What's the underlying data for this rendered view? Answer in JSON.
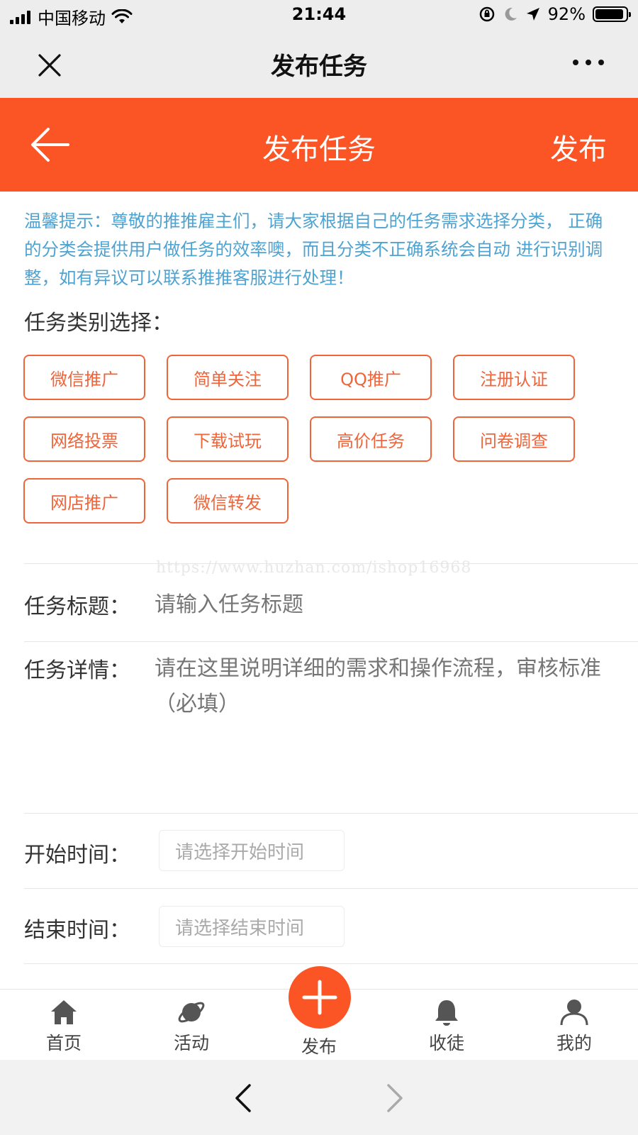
{
  "status_bar": {
    "carrier": "中国移动",
    "time": "21:44",
    "battery": "92%",
    "battery_level": 0.92
  },
  "wechat": {
    "title": "发布任务"
  },
  "header": {
    "title": "发布任务",
    "publish_label": "发布"
  },
  "tip": "温馨提示：尊敬的推推雇主们，请大家根据自己的任务需求选择分类， 正确的分类会提供用户做任务的效率噢，而且分类不正确系统会自动 进行识别调整，如有异议可以联系推推客服进行处理！",
  "category_label": "任务类别选择：",
  "categories": [
    "微信推广",
    "简单关注",
    "QQ推广",
    "注册认证",
    "网络投票",
    "下载试玩",
    "高价任务",
    "问卷调查",
    "网店推广",
    "微信转发"
  ],
  "watermark": "https://www.huzhan.com/ishop16968",
  "form": {
    "title_label": "任务标题：",
    "title_placeholder": "请输入任务标题",
    "detail_label": "任务详情：",
    "detail_placeholder": "请在这里说明详细的需求和操作流程，审核标准（必填）",
    "start_label": "开始时间：",
    "start_placeholder": "请选择开始时间",
    "end_label": "结束时间：",
    "end_placeholder": "请选择结束时间"
  },
  "tabbar": {
    "home": "首页",
    "activity": "活动",
    "publish": "发布",
    "apprentice": "收徒",
    "mine": "我的"
  },
  "colors": {
    "accent": "#fb5425",
    "tip": "#4fa3d1",
    "chip_border": "#f0643a"
  }
}
